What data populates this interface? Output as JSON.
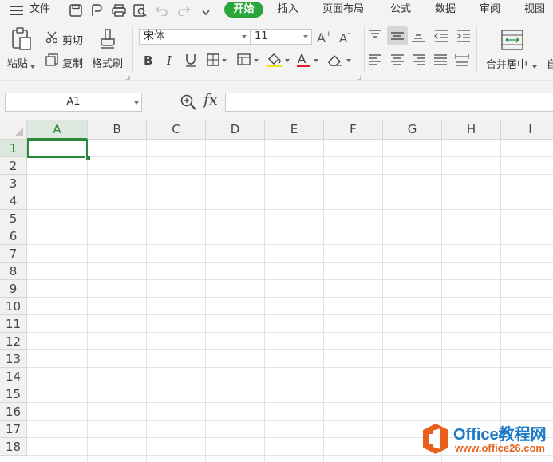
{
  "menubar": {
    "menu_label": "文件",
    "tabs": [
      {
        "label": "开始",
        "active": true
      },
      {
        "label": "插入"
      },
      {
        "label": "页面布局"
      },
      {
        "label": "公式"
      },
      {
        "label": "数据"
      },
      {
        "label": "审阅"
      },
      {
        "label": "视图"
      }
    ]
  },
  "ribbon": {
    "paste_label": "粘贴",
    "cut_label": "剪切",
    "copy_label": "复制",
    "format_painter_label": "格式刷",
    "font_name": "宋体",
    "font_size": "11",
    "merge_center_label": "合并居中",
    "truncated_label": "自"
  },
  "formula_bar": {
    "name_box": "A1",
    "fx_label": "fx",
    "formula_value": ""
  },
  "sheet": {
    "columns": [
      "A",
      "B",
      "C",
      "D",
      "E",
      "F",
      "G",
      "H",
      "I"
    ],
    "rows": [
      "1",
      "2",
      "3",
      "4",
      "5",
      "6",
      "7",
      "8",
      "9",
      "10",
      "11",
      "12",
      "13",
      "14",
      "15",
      "16",
      "17",
      "18"
    ],
    "active_cell": "A1"
  },
  "watermark": {
    "title": "Office教程网",
    "url": "www.office26.com"
  },
  "colors": {
    "accent": "#2aa63a",
    "selection": "#2a8a3a",
    "font_color_underline": "#e02020",
    "fill_color_underline": "#f0e020"
  }
}
